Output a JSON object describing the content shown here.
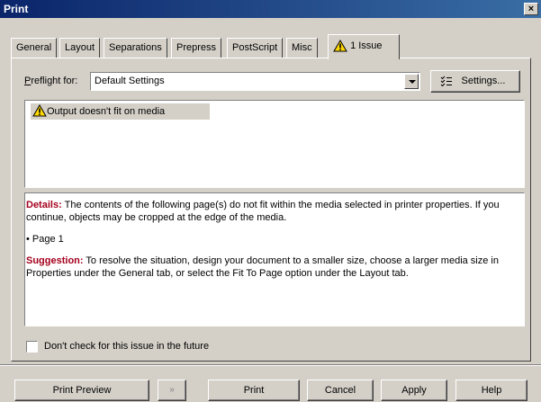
{
  "window": {
    "title": "Print",
    "close_label": "×"
  },
  "tabs": [
    {
      "label": "General"
    },
    {
      "label": "Layout"
    },
    {
      "label": "Separations"
    },
    {
      "label": "Prepress"
    },
    {
      "label": "PostScript"
    },
    {
      "label": "Misc"
    },
    {
      "label": "1 Issue",
      "icon": "warning-icon",
      "active": true
    }
  ],
  "preflight": {
    "label_prefix": "P",
    "label_rest": "reflight for:",
    "selected": "Default Settings",
    "settings_button": "Settings..."
  },
  "issues": [
    {
      "icon": "warning-icon",
      "text": "Output doesn't fit on media"
    }
  ],
  "details": {
    "details_label": "Details:",
    "details_text": " The contents of the following page(s) do not fit within the media selected in printer properties. If you continue, objects may be cropped at the edge of the media.",
    "bullet": "• Page 1",
    "suggestion_label": "Suggestion:",
    "suggestion_text": " To resolve the situation, design your document to a smaller size, choose a larger media size in Properties under the General tab, or select the Fit To Page option under the Layout tab."
  },
  "checkbox": {
    "label": "Don't check for this issue in the future",
    "checked": false
  },
  "buttons": {
    "print_preview": "Print Preview",
    "expand": "»",
    "print": "Print",
    "cancel": "Cancel",
    "apply": "Apply",
    "help": "Help"
  },
  "colors": {
    "titlebar": "#0a246a",
    "face": "#d4d0c8",
    "keyword": "#a4001c",
    "warning": "#ffd800"
  }
}
